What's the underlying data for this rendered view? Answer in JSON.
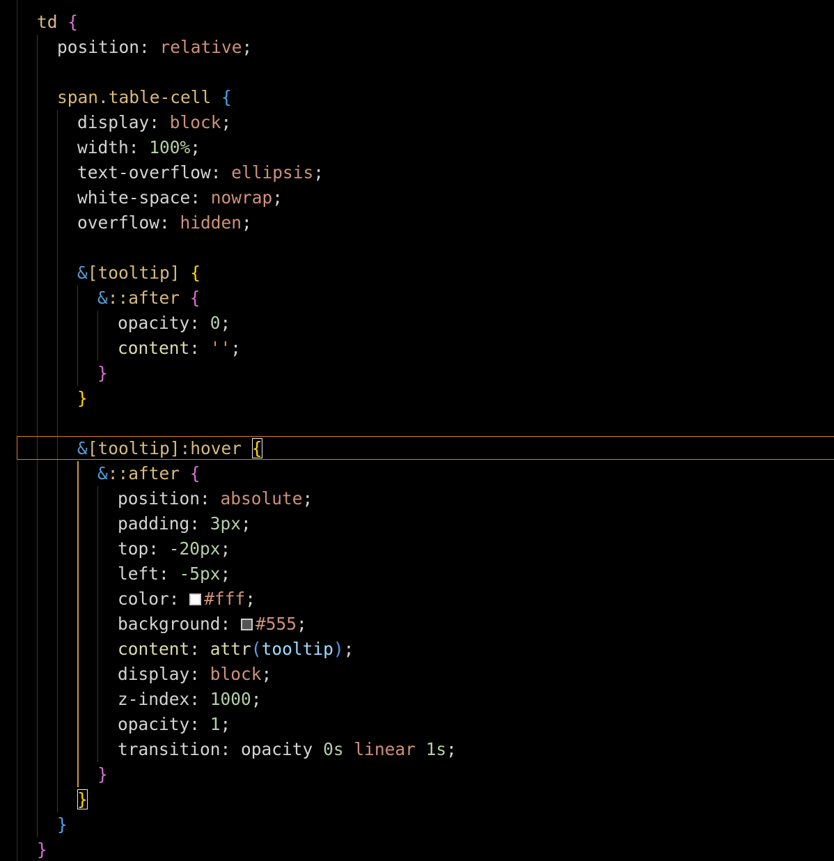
{
  "editor": {
    "language": "scss",
    "theme_colors": {
      "background": "#000000",
      "selector": "#d7ba7d",
      "value": "#ce9178",
      "number": "#b5cea8",
      "ampersand": "#569cd6",
      "bracket_level_1": "#da70d6",
      "bracket_level_2": "#4fa3f0",
      "bracket_level_3": "#ffd700",
      "current_line_border": "#e07a1f"
    },
    "current_line": 18
  },
  "code": {
    "l1_sel": "td",
    "l1_b": "{",
    "l2_prop": "position",
    "l2_val": "relative",
    "l4_sel": "span.table-cell",
    "l4_b": "{",
    "l5_prop": "display",
    "l5_val": "block",
    "l6_prop": "width",
    "l6_val": "100%",
    "l7_prop": "text-overflow",
    "l7_val": "ellipsis",
    "l8_prop": "white-space",
    "l8_val": "nowrap",
    "l9_prop": "overflow",
    "l9_val": "hidden",
    "l11_amp": "&",
    "l11_sel": "[tooltip]",
    "l11_b": "{",
    "l12_amp": "&",
    "l12_sel": "::after",
    "l12_b": "{",
    "l13_prop": "opacity",
    "l13_val": "0",
    "l14_prop": "content",
    "l14_val": "''",
    "l15_b": "}",
    "l16_b": "}",
    "l18_amp": "&",
    "l18_sel": "[tooltip]:hover",
    "l18_b": "{",
    "l19_amp": "&",
    "l19_sel": "::after",
    "l19_b": "{",
    "l20_prop": "position",
    "l20_val": "absolute",
    "l21_prop": "padding",
    "l21_val": "3px",
    "l22_prop": "top",
    "l22_val": "-20px",
    "l23_prop": "left",
    "l23_val": "-5px",
    "l24_prop": "color",
    "l24_val": "#fff",
    "l24_swatch": "#ffffff",
    "l25_prop": "background",
    "l25_val": "#555",
    "l25_swatch": "#555555",
    "l26_prop": "content",
    "l26_fn": "attr",
    "l26_arg": "tooltip",
    "l27_prop": "display",
    "l27_val": "block",
    "l28_prop": "z-index",
    "l28_val": "1000",
    "l29_prop": "opacity",
    "l29_val": "1",
    "l30_prop": "transition",
    "l30_v1": "opacity",
    "l30_v2": "0s",
    "l30_v3": "linear",
    "l30_v4": "1s",
    "l31_b": "}",
    "l32_b": "}",
    "l33_b": "}",
    "l34_b": "}"
  }
}
